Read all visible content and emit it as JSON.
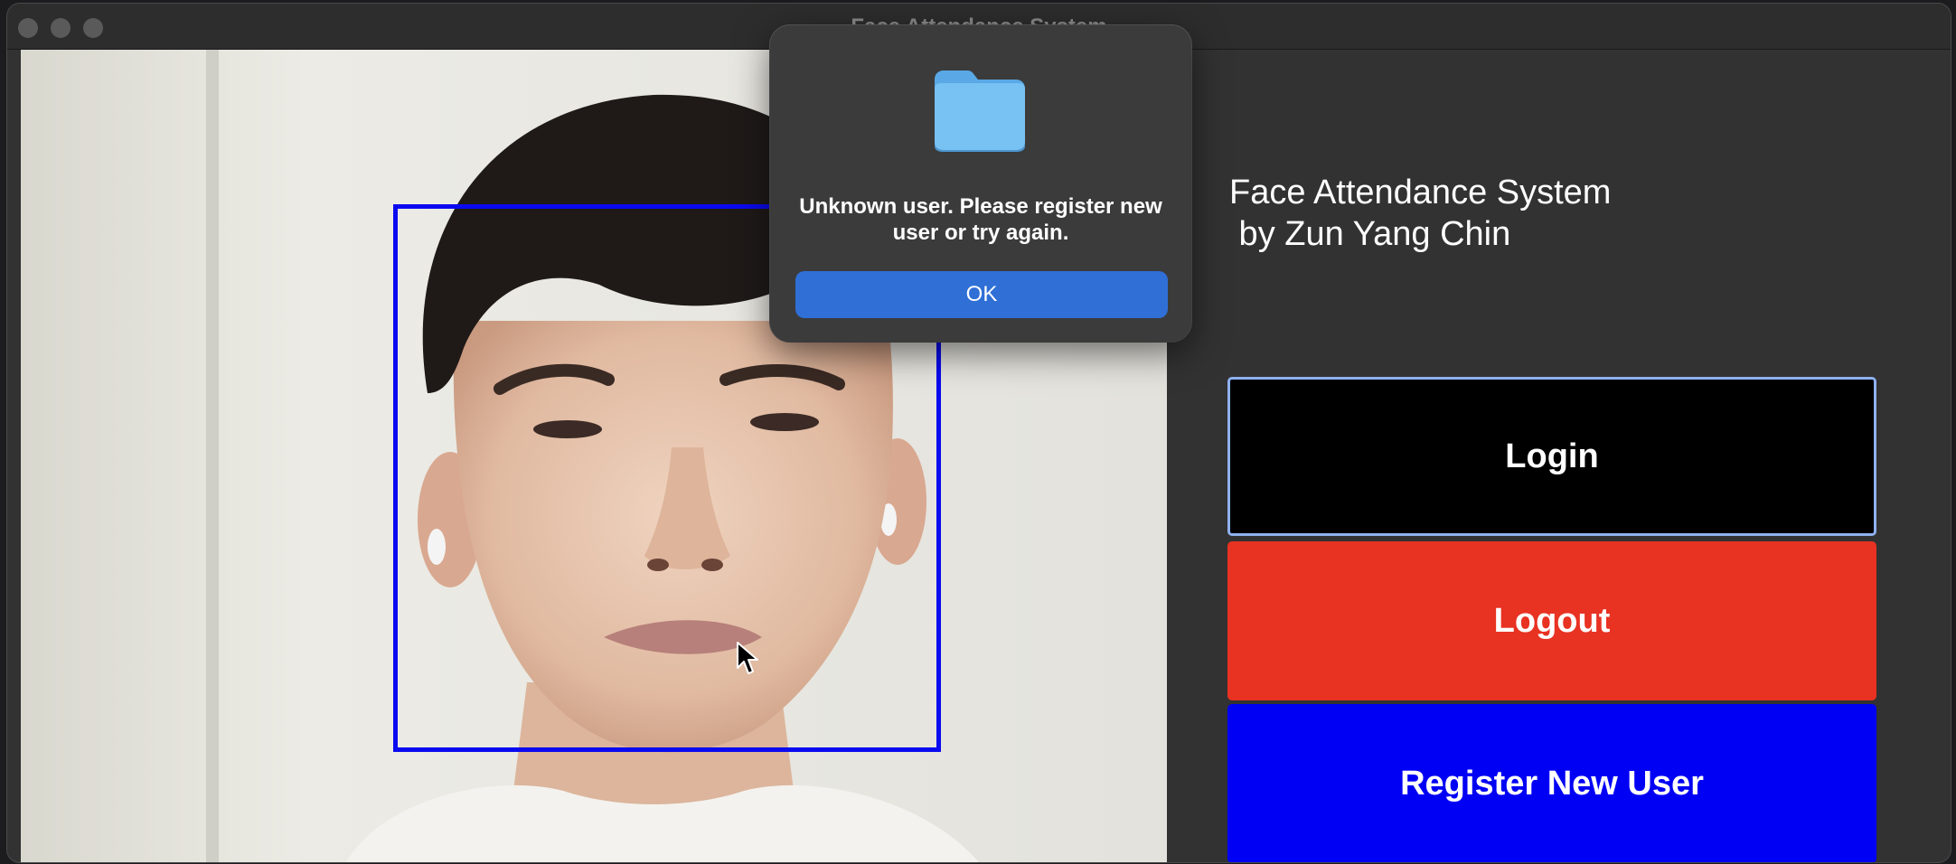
{
  "window": {
    "title": "Face Attendance System"
  },
  "camera": {
    "description_icon": "webcam-feed",
    "detection_box_color": "#0a0af0"
  },
  "app": {
    "title": "Face Attendance System\n by Zun Yang Chin"
  },
  "buttons": {
    "login": "Login",
    "logout": "Logout",
    "register": "Register New User"
  },
  "colors": {
    "login_bg": "#000000",
    "logout_bg": "#e83222",
    "register_bg": "#0000f5",
    "dialog_ok_bg": "#2f6fd6"
  },
  "dialog": {
    "icon": "folder-icon",
    "message": "Unknown user. Please register new user or try again.",
    "ok_label": "OK"
  }
}
